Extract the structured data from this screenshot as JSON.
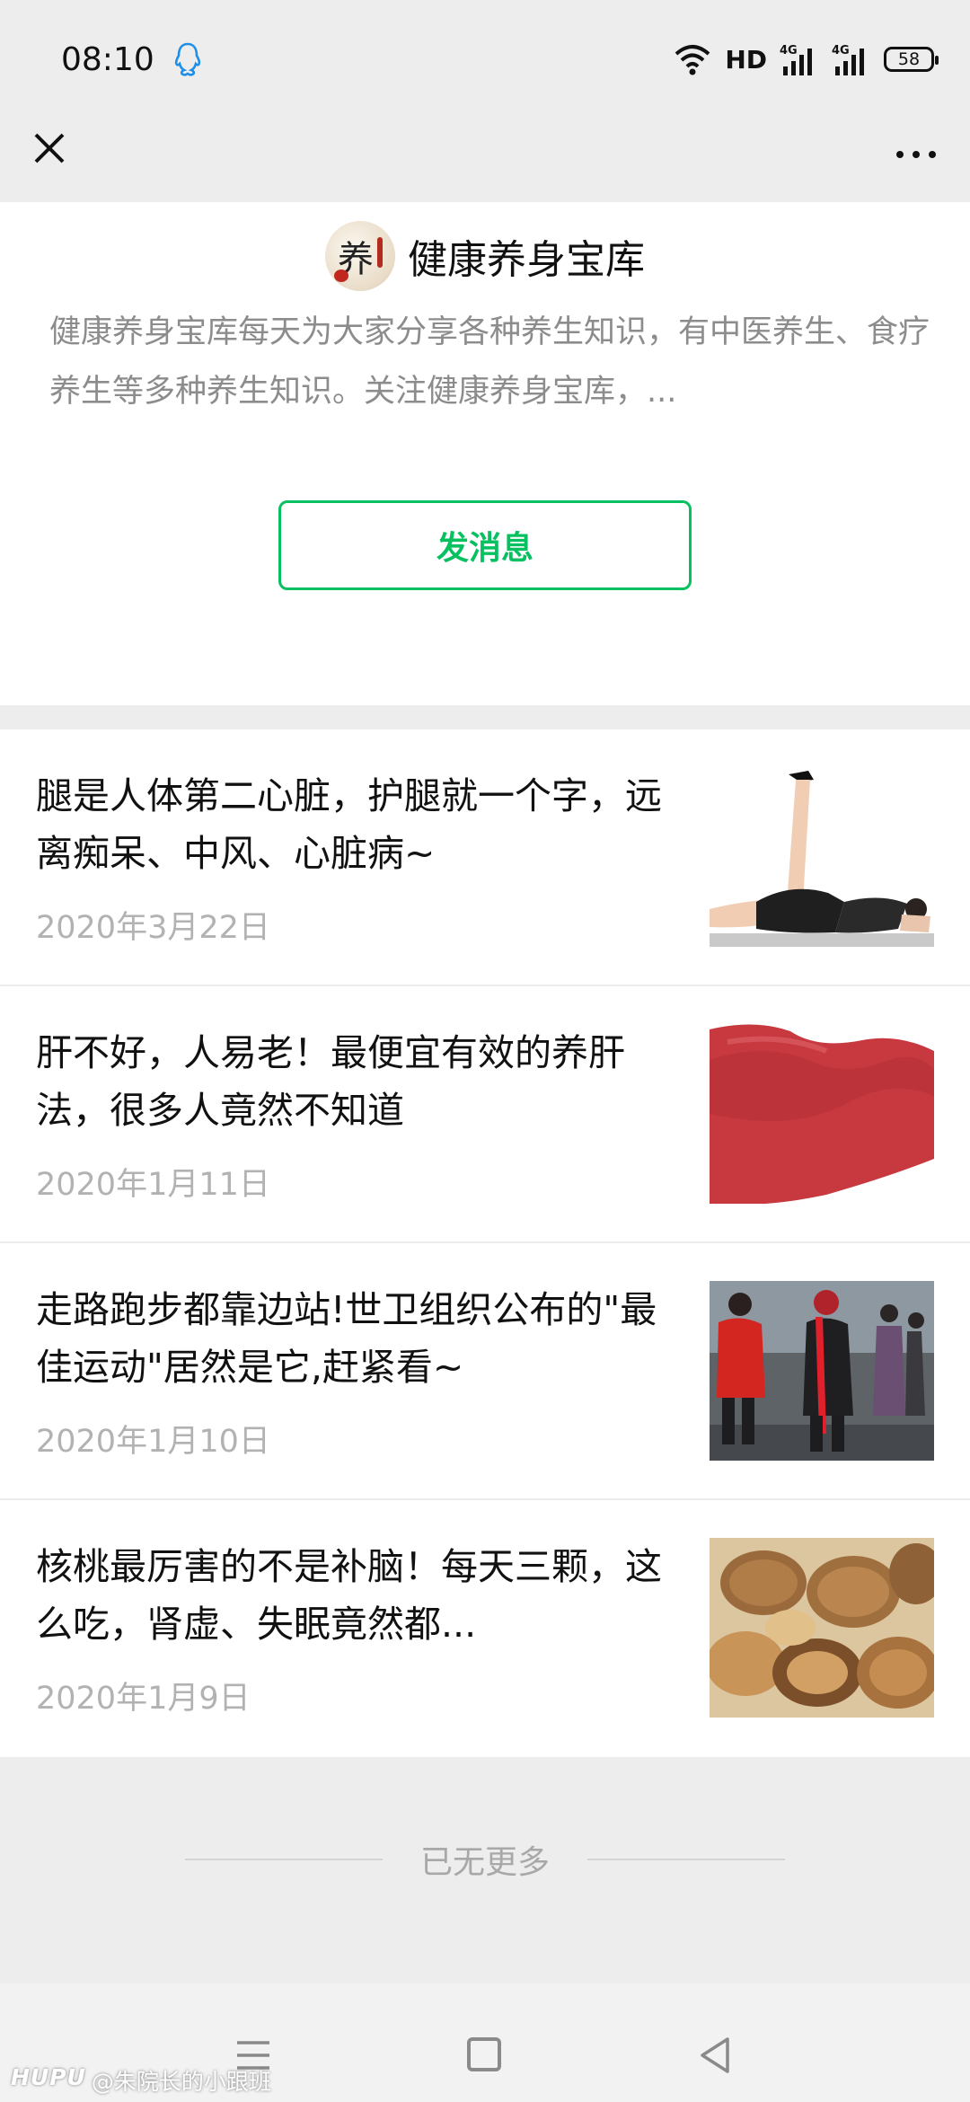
{
  "status_bar": {
    "time": "08:10",
    "network_label": "HD",
    "battery": "58",
    "icons": [
      "qq-icon",
      "wifi-icon",
      "signal-4g-icon",
      "signal-4g-icon",
      "battery-icon"
    ]
  },
  "nav_bar": {
    "close_icon": "close-icon",
    "more_icon": "more-icon"
  },
  "profile": {
    "name": "健康养身宝库",
    "description": "健康养身宝库每天为大家分享各种养生知识，有中医养生、食疗养生等多种养生知识。关注健康养身宝库，...",
    "send_button": "发消息",
    "accent_color": "#07c160"
  },
  "articles": [
    {
      "title": "腿是人体第二心脏，护腿就一个字，远离痴呆、中风、心脏病~",
      "date": "2020年3月22日",
      "thumb": "leg-exercise-image"
    },
    {
      "title": "肝不好，人易老！最便宜有效的养肝法，很多人竟然不知道",
      "date": "2020年1月11日",
      "thumb": "liver-image"
    },
    {
      "title": "走路跑步都靠边站!世卫组织公布的\"最佳运动\"居然是它,赶紧看~",
      "date": "2020年1月10日",
      "thumb": "dancing-people-image"
    },
    {
      "title": "核桃最厉害的不是补脑！每天三颗，这么吃，肾虚、失眠竟然都...",
      "date": "2020年1月9日",
      "thumb": "walnuts-image"
    }
  ],
  "footer": {
    "no_more_text": "已无更多"
  },
  "system_nav": {
    "icons": [
      "menu-key-icon",
      "home-key-icon",
      "back-key-icon"
    ]
  },
  "watermark": {
    "brand": "HUPU",
    "user": "@朱院长的小跟班"
  }
}
